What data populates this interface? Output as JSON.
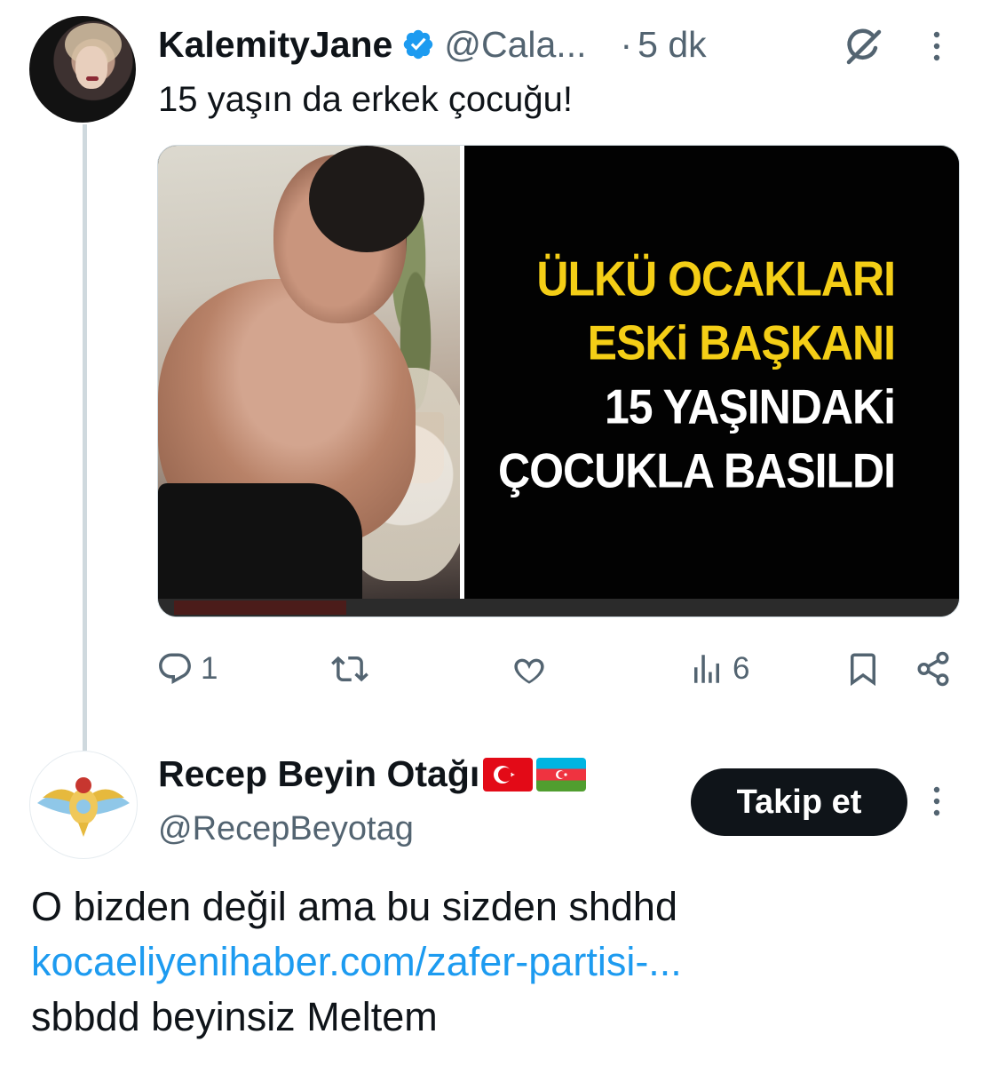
{
  "tweet": {
    "author_name": "KalemityJane",
    "author_handle": "@Cala...",
    "separator": "·",
    "time": "5 dk",
    "text": "15 yaşın da erkek çocuğu!",
    "media": {
      "headline_lines": [
        "ÜLKÜ OCAKLARI",
        "ESKi BAŞKANI",
        "15 YAŞINDAKi",
        "ÇOCUKLA BASILDI"
      ],
      "headline_colors": [
        "#f4ce16",
        "#f4ce16",
        "#ffffff",
        "#ffffff"
      ],
      "video_progress": 0.22
    },
    "actions": {
      "reply_count": "1",
      "retweet_count": "",
      "like_count": "",
      "views_count": "6"
    }
  },
  "reply": {
    "author_name": "Recep Beyin Otağı",
    "author_handle": "@RecepBeyotag",
    "follow_label": "Takip et",
    "text_line1": "O bizden değil ama bu sizden shdhd",
    "link": "kocaeliyenihaber.com/zafer-partisi-...",
    "text_line3": "sbbdd beyinsiz Meltem"
  },
  "colors": {
    "accent": "#1d9bf0",
    "text": "#0f1419",
    "muted": "#536471",
    "verified": "#1d9bf0"
  },
  "icons": [
    "verified-badge-icon",
    "grok-icon",
    "more-icon",
    "reply-icon",
    "retweet-icon",
    "like-icon",
    "views-icon",
    "bookmark-icon",
    "share-icon",
    "turkey-flag-icon",
    "azerbaijan-flag-icon"
  ]
}
